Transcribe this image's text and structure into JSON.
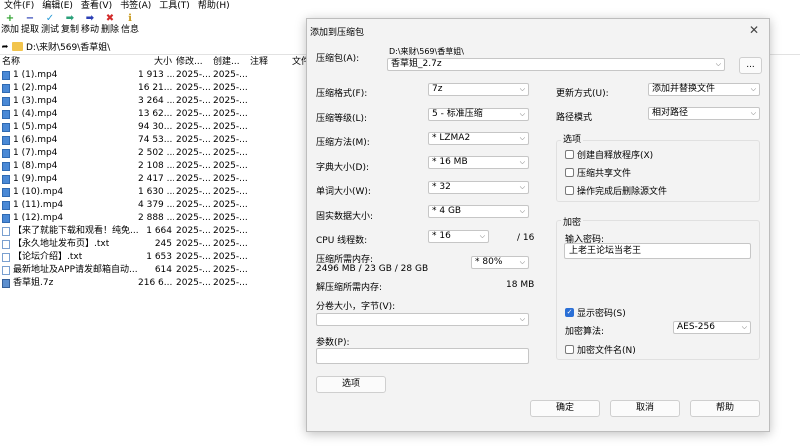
{
  "menubar": [
    "文件(F)",
    "编辑(E)",
    "查看(V)",
    "书签(A)",
    "工具(T)",
    "帮助(H)"
  ],
  "toolbar": [
    {
      "label": "添加",
      "icon": "plus-icon",
      "color": "#2aa02a",
      "glyph": "+"
    },
    {
      "label": "提取",
      "icon": "minus-icon",
      "color": "#2b3fb5",
      "glyph": "−"
    },
    {
      "label": "测试",
      "icon": "check-icon",
      "color": "#2a9bd6",
      "glyph": "✓"
    },
    {
      "label": "复制",
      "icon": "arrow-right-icon",
      "color": "#2aa07a",
      "glyph": "➡"
    },
    {
      "label": "移动",
      "icon": "arrow-right-icon",
      "color": "#2b3fb5",
      "glyph": "➡"
    },
    {
      "label": "删除",
      "icon": "delete-x-icon",
      "color": "#d22a2a",
      "glyph": "✖"
    },
    {
      "label": "信息",
      "icon": "info-icon",
      "color": "#c89a1e",
      "glyph": "ℹ"
    }
  ],
  "address": {
    "path": "D:\\来财\\569\\香草姐\\"
  },
  "columns": {
    "name": "名称",
    "size": "大小",
    "modified": "修改...",
    "created": "创建...",
    "comment": "注释",
    "folder": "文件"
  },
  "files": [
    {
      "name": "1 (1).mp4",
      "size": "1 913 ...",
      "modified": "2025-...",
      "created": "2025-...",
      "type": "video"
    },
    {
      "name": "1 (2).mp4",
      "size": "16 21...",
      "modified": "2025-...",
      "created": "2025-...",
      "type": "video"
    },
    {
      "name": "1 (3).mp4",
      "size": "3 264 ...",
      "modified": "2025-...",
      "created": "2025-...",
      "type": "video"
    },
    {
      "name": "1 (4).mp4",
      "size": "13 62...",
      "modified": "2025-...",
      "created": "2025-...",
      "type": "video"
    },
    {
      "name": "1 (5).mp4",
      "size": "94 30...",
      "modified": "2025-...",
      "created": "2025-...",
      "type": "video"
    },
    {
      "name": "1 (6).mp4",
      "size": "74 53...",
      "modified": "2025-...",
      "created": "2025-...",
      "type": "video"
    },
    {
      "name": "1 (7).mp4",
      "size": "2 502 ...",
      "modified": "2025-...",
      "created": "2025-...",
      "type": "video"
    },
    {
      "name": "1 (8).mp4",
      "size": "2 108 ...",
      "modified": "2025-...",
      "created": "2025-...",
      "type": "video"
    },
    {
      "name": "1 (9).mp4",
      "size": "2 417 ...",
      "modified": "2025-...",
      "created": "2025-...",
      "type": "video"
    },
    {
      "name": "1 (10).mp4",
      "size": "1 630 ...",
      "modified": "2025-...",
      "created": "2025-...",
      "type": "video"
    },
    {
      "name": "1 (11).mp4",
      "size": "4 379 ...",
      "modified": "2025-...",
      "created": "2025-...",
      "type": "video"
    },
    {
      "name": "1 (12).mp4",
      "size": "2 888 ...",
      "modified": "2025-...",
      "created": "2025-...",
      "type": "video"
    },
    {
      "name": "【来了就能下载和观看！纯免...",
      "size": "1 664",
      "modified": "2025-...",
      "created": "2025-...",
      "type": "text"
    },
    {
      "name": "【永久地址发布页】.txt",
      "size": "245",
      "modified": "2025-...",
      "created": "2025-...",
      "type": "text"
    },
    {
      "name": "【论坛介绍】.txt",
      "size": "1 653",
      "modified": "2025-...",
      "created": "2025-...",
      "type": "text"
    },
    {
      "name": "最新地址及APP请发邮箱自动...",
      "size": "614",
      "modified": "2025-...",
      "created": "2025-...",
      "type": "text"
    },
    {
      "name": "香草姐.7z",
      "size": "216 6...",
      "modified": "2025-...",
      "created": "2025-...",
      "type": "arch"
    }
  ],
  "dialog": {
    "title": "添加到压缩包",
    "close": "✕",
    "archive_label": "压缩包(A):",
    "archive_dir": "D:\\来财\\569\\香草姐\\",
    "archive_name": "香草姐_2.7z",
    "browse": "...",
    "format_label": "压缩格式(F):",
    "format_value": "7z",
    "level_label": "压缩等级(L):",
    "level_value": "5 - 标准压缩",
    "method_label": "压缩方法(M):",
    "method_value": "*  LZMA2",
    "dict_label": "字典大小(D):",
    "dict_value": "*  16 MB",
    "word_label": "单词大小(W):",
    "word_value": "*  32",
    "solid_label": "固实数据大小:",
    "solid_value": "*  4 GB",
    "cpu_label": "CPU 线程数:",
    "cpu_value": "*  16",
    "cpu_total": "/ 16",
    "mem_label": "压缩所需内存:",
    "mem_values": "2496 MB / 23 GB / 28 GB",
    "mem_percent": "* 80%",
    "demem_label": "解压缩所需内存:",
    "demem_value": "18 MB",
    "split_label": "分卷大小，字节(V):",
    "split_value": "",
    "params_label": "参数(P):",
    "params_value": "",
    "options_btn": "选项",
    "update_label": "更新方式(U):",
    "update_value": "添加并替换文件",
    "path_label": "路径模式",
    "path_value": "相对路径",
    "options_group": "选项",
    "opt_sfx": "创建自释放程序(X)",
    "opt_shared": "压缩共享文件",
    "opt_delete": "操作完成后删除源文件",
    "encrypt_group": "加密",
    "password_label": "输入密码:",
    "password_value": "上老王论坛当老王",
    "show_password": "显示密码(S)",
    "enc_method_label": "加密算法:",
    "enc_method_value": "AES-256",
    "enc_names": "加密文件名(N)",
    "ok": "确定",
    "cancel": "取消",
    "help": "帮助"
  }
}
